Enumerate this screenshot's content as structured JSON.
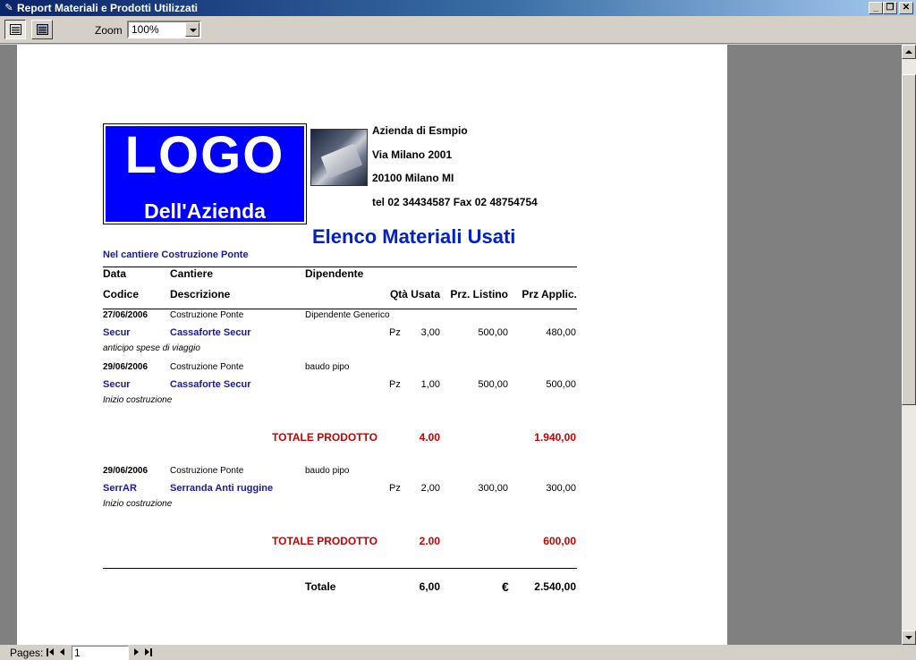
{
  "window": {
    "title": "Report Materiali e Prodotti Utilizzati",
    "minimize": "_",
    "restore": "❐",
    "close": "✕"
  },
  "toolbar": {
    "zoom_label": "Zoom",
    "zoom_value": "100%"
  },
  "statusbar": {
    "pages_label": "Pages:",
    "current_page": "1"
  },
  "report": {
    "logo_line1": "LOGO",
    "logo_line2": "Dell'Azienda",
    "company": {
      "name": "Azienda di Esmpio",
      "address": "Via Milano 2001",
      "city": "20100 Milano MI",
      "contacts": "tel 02 34434587  Fax 02 48754754"
    },
    "title": "Elenco Materiali Usati",
    "site_heading": "Nel cantiere Costruzione Ponte",
    "headers": {
      "data": "Data",
      "cantiere": "Cantiere",
      "dipendente": "Dipendente",
      "codice": "Codice",
      "descrizione": "Descrizione",
      "qta": "Qtà Usata",
      "prz_listino": "Prz. Listino",
      "prz_applic": "Prz Applic."
    },
    "groups": [
      {
        "entries": [
          {
            "date": "27/06/2006",
            "site": "Costruzione Ponte",
            "employee": "Dipendente Generico",
            "code": "Secur",
            "description": "Cassaforte Secur",
            "unit": "Pz",
            "qty": "3,00",
            "list_price": "500,00",
            "applied_price": "480,00",
            "note": "anticipo spese di viaggio"
          },
          {
            "date": "29/06/2006",
            "site": "Costruzione Ponte",
            "employee": "baudo pipo",
            "code": "Secur",
            "description": "Cassaforte Secur",
            "unit": "Pz",
            "qty": "1,00",
            "list_price": "500,00",
            "applied_price": "500,00",
            "note": "Inizio costruzione"
          }
        ],
        "total_label": "TOTALE PRODOTTO",
        "total_qty": "4.00",
        "total_amount": "1.940,00"
      },
      {
        "entries": [
          {
            "date": "29/06/2006",
            "site": "Costruzione Ponte",
            "employee": "baudo pipo",
            "code": "SerrAR",
            "description": "Serranda Anti ruggine",
            "unit": "Pz",
            "qty": "2,00",
            "list_price": "300,00",
            "applied_price": "300,00",
            "note": "Inizio costruzione"
          }
        ],
        "total_label": "TOTALE PRODOTTO",
        "total_qty": "2.00",
        "total_amount": "600,00"
      }
    ],
    "grand_total": {
      "label": "Totale",
      "qty": "6,00",
      "currency": "€",
      "amount": "2.540,00"
    }
  }
}
